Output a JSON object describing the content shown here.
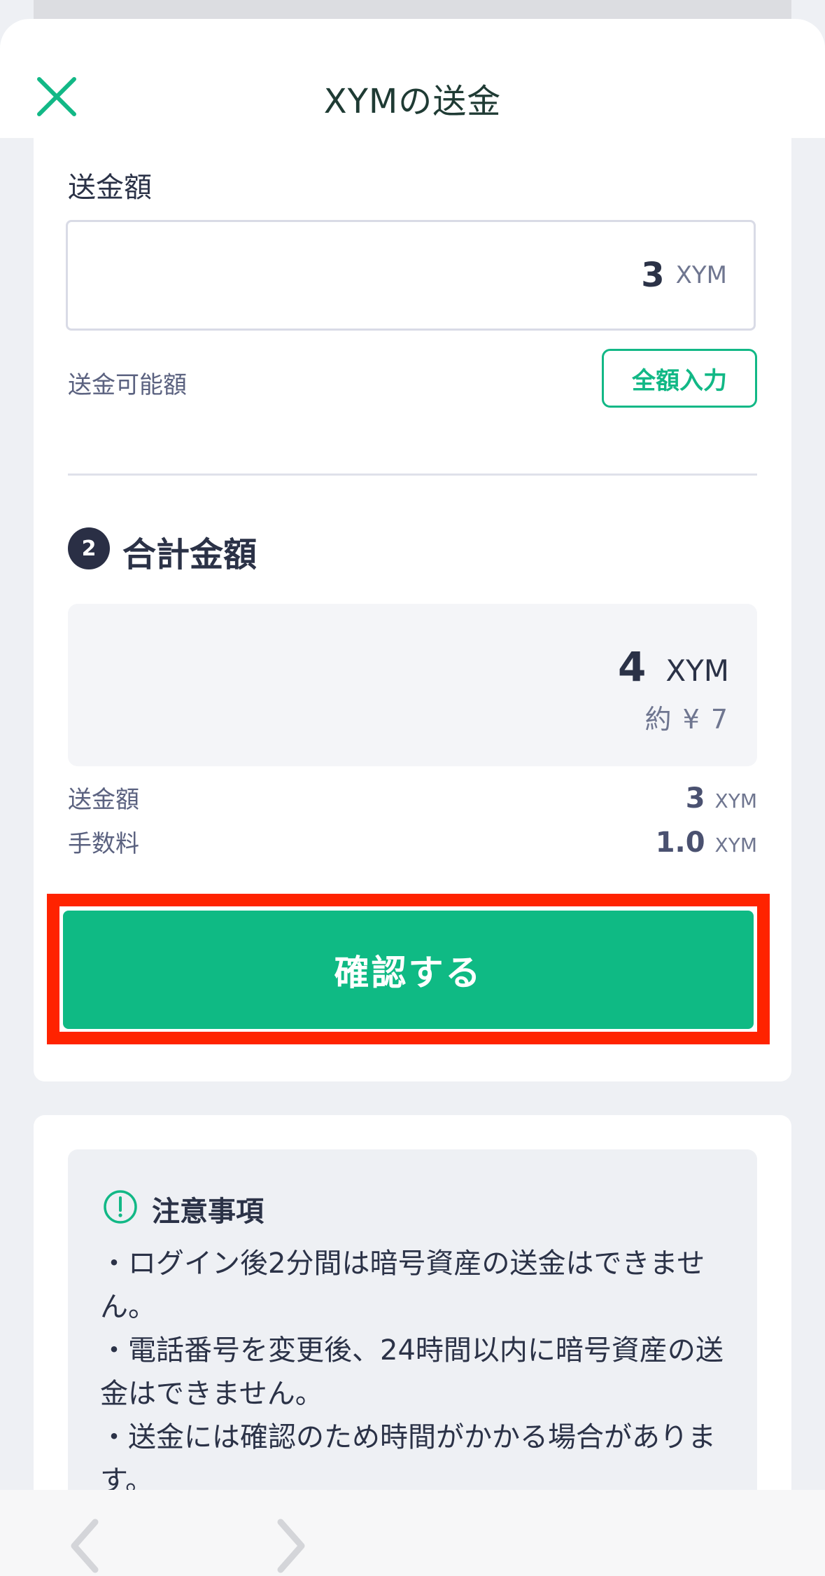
{
  "header": {
    "title": "XYMの送金"
  },
  "amount_section": {
    "label": "送金額",
    "input_value": "3",
    "input_unit": "XYM",
    "available_label": "送金可能額",
    "fill_all_button": "全額入力"
  },
  "total_section": {
    "step_number": "2",
    "title": "合計金額",
    "total_value": "4",
    "total_unit": "XYM",
    "total_jpy": "約 ¥ 7",
    "rows": [
      {
        "label": "送金額",
        "value": "3",
        "unit": "XYM"
      },
      {
        "label": "手数料",
        "value": "1.0",
        "unit": "XYM"
      }
    ]
  },
  "confirm_button": "確認する",
  "notes": {
    "title": "注意事項",
    "lines": [
      "・ログイン後2分間は暗号資産の送金はできません。",
      "・電話番号を変更後、24時間以内に暗号資産の送金はできません。",
      "・送金には確認のため時間がかかる場合があります。"
    ]
  },
  "colors": {
    "accent": "#0fba84",
    "highlight": "#ff2300",
    "dark": "#2a2f45"
  },
  "icons": {
    "close": "close-icon",
    "notes": "exclamation-circle-icon",
    "back": "chevron-left-icon",
    "forward": "chevron-right-icon"
  }
}
